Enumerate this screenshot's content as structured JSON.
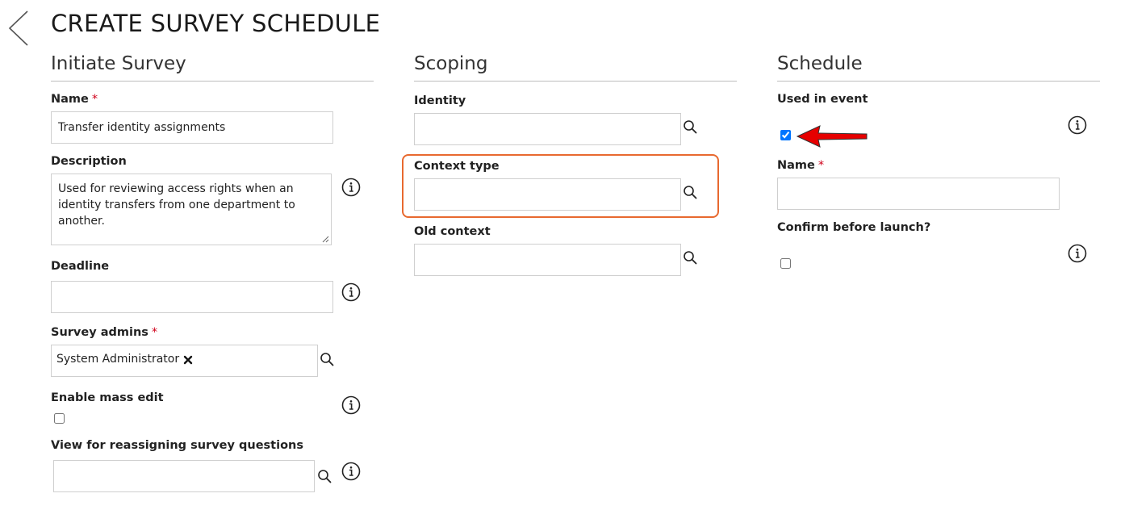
{
  "page": {
    "title": "CREATE SURVEY SCHEDULE"
  },
  "sections": {
    "initiate": {
      "title": "Initiate Survey",
      "name_label": "Name",
      "name_value": "Transfer identity assignments",
      "description_label": "Description",
      "description_value": "Used for reviewing access rights when an identity transfers from one department to another.",
      "deadline_label": "Deadline",
      "deadline_value": "",
      "admins_label": "Survey admins",
      "admins_chip": "System Administrator",
      "mass_edit_label": "Enable mass edit",
      "mass_edit_checked": false,
      "view_label": "View for reassigning survey questions",
      "view_value": ""
    },
    "scoping": {
      "title": "Scoping",
      "identity_label": "Identity",
      "identity_value": "",
      "context_type_label": "Context type",
      "context_type_value": "",
      "old_context_label": "Old context",
      "old_context_value": ""
    },
    "schedule": {
      "title": "Schedule",
      "used_in_event_label": "Used in event",
      "used_in_event_checked": true,
      "name_label": "Name",
      "name_value": "",
      "confirm_label": "Confirm before launch?",
      "confirm_checked": false
    }
  },
  "common": {
    "required_mark": "*"
  },
  "colors": {
    "required": "#d0021b",
    "highlight": "#e8692f",
    "annotation_arrow": "#e60000",
    "border": "#cfcfcf"
  },
  "icons": {
    "back": "chevron-left-icon",
    "search": "search-icon",
    "info": "info-icon",
    "remove": "close-icon"
  }
}
